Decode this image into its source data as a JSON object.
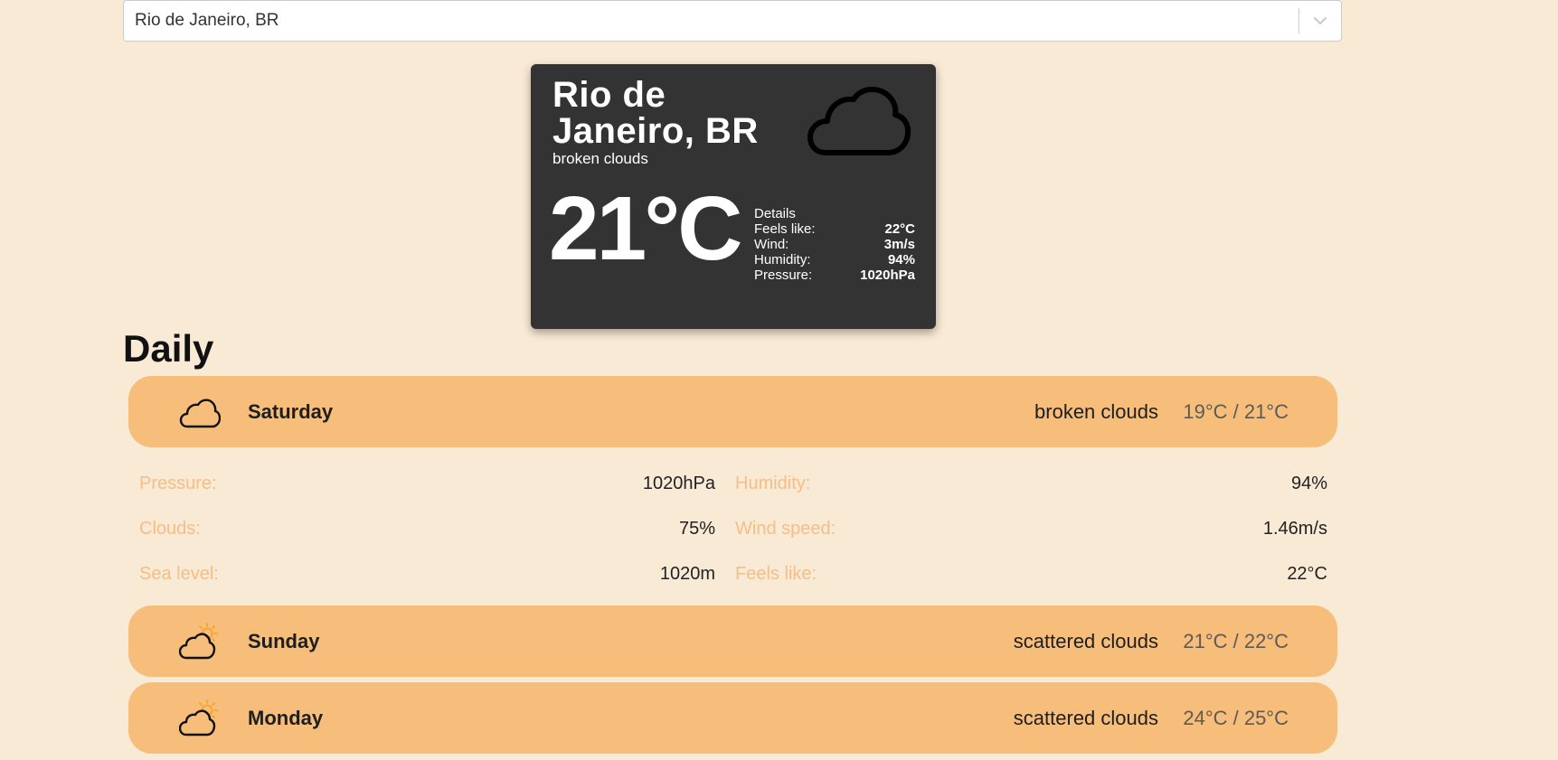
{
  "search": {
    "value": "Rio de Janeiro, BR"
  },
  "current": {
    "city": "Rio de Janeiro, BR",
    "description": "broken clouds",
    "temperature": "21°C",
    "icon": "cloud-icon",
    "details_title": "Details",
    "details": [
      {
        "label": "Feels like:",
        "value": "22°C"
      },
      {
        "label": "Wind:",
        "value": "3m/s"
      },
      {
        "label": "Humidity:",
        "value": "94%"
      },
      {
        "label": "Pressure:",
        "value": "1020hPa"
      }
    ]
  },
  "daily": {
    "title": "Daily",
    "days": [
      {
        "name": "Saturday",
        "description": "broken clouds",
        "temp": "19°C / 21°C",
        "icon": "cloud-icon"
      },
      {
        "name": "Sunday",
        "description": "scattered clouds",
        "temp": "21°C / 22°C",
        "icon": "partly-sunny-icon"
      },
      {
        "name": "Monday",
        "description": "scattered clouds",
        "temp": "24°C / 25°C",
        "icon": "partly-sunny-icon"
      }
    ],
    "expanded_details": [
      [
        {
          "label": "Pressure:",
          "value": "1020hPa"
        },
        {
          "label": "Humidity:",
          "value": "94%"
        }
      ],
      [
        {
          "label": "Clouds:",
          "value": "75%"
        },
        {
          "label": "Wind speed:",
          "value": "1.46m/s"
        }
      ],
      [
        {
          "label": "Sea level:",
          "value": "1020m"
        },
        {
          "label": "Feels like:",
          "value": "22°C"
        }
      ]
    ]
  },
  "colors": {
    "background": "#f9ead6",
    "card": "#333333",
    "day_bar": "#f7bd7a",
    "detail_label": "#f4be86",
    "sun": "#f5a623"
  }
}
